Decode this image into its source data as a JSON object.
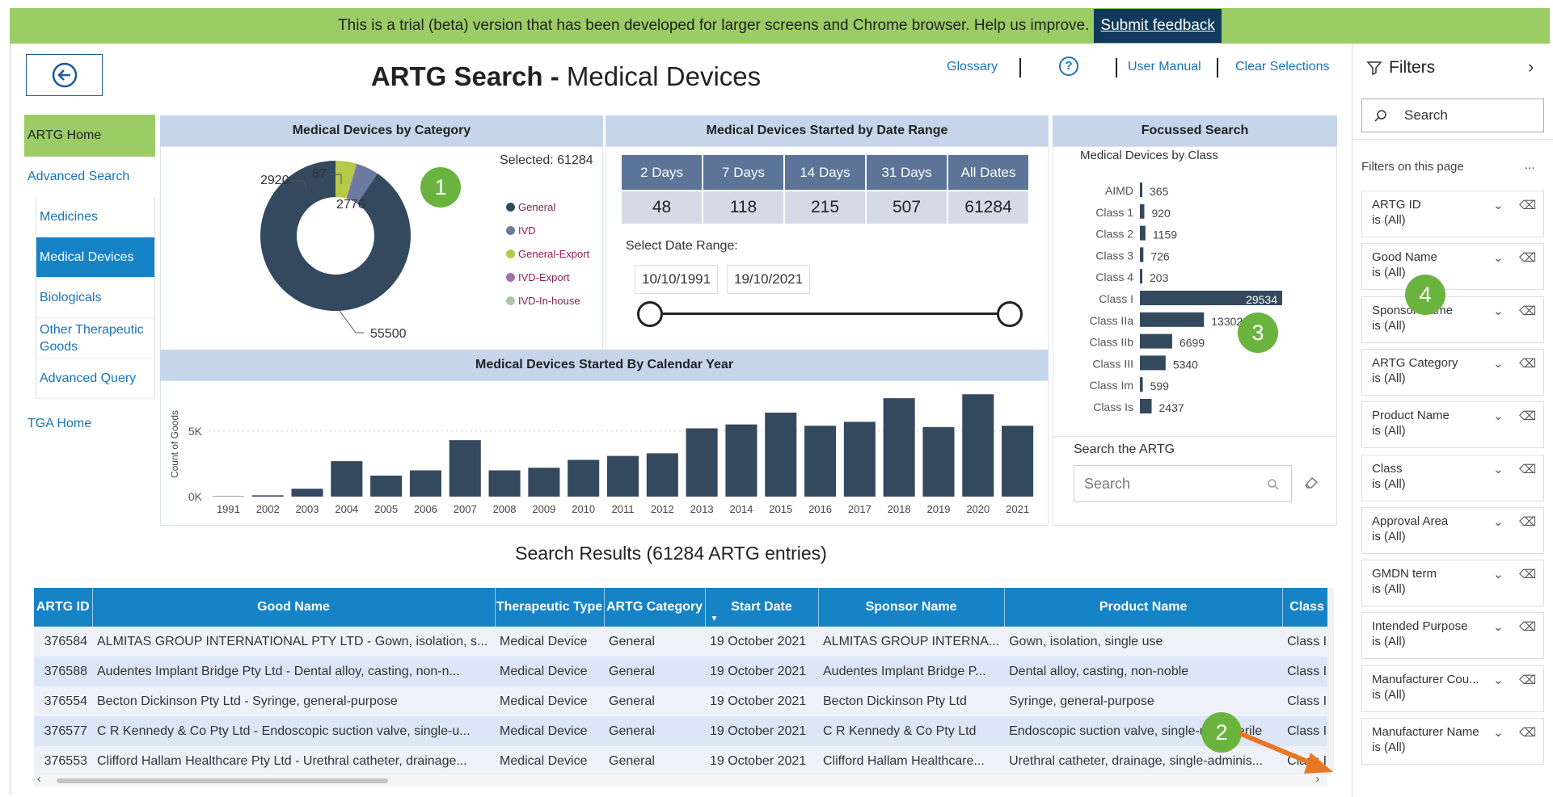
{
  "banner": {
    "message": "This is a trial (beta) version that has been developed for larger screens and Chrome browser. Help us improve.",
    "feedback_label": "Submit feedback"
  },
  "header": {
    "title_bold": "ARTG Search - ",
    "title_rest": "Medical Devices",
    "links": {
      "glossary": "Glossary",
      "help": "?",
      "manual": "User Manual",
      "clear": "Clear Selections"
    }
  },
  "nav": {
    "home": "ARTG Home",
    "advanced": "Advanced Search",
    "items": [
      "Medicines",
      "Medical Devices",
      "Biologicals",
      "Other Therapeutic Goods",
      "Advanced Query"
    ],
    "tga": "TGA Home"
  },
  "category_panel": {
    "title": "Medical Devices by Category",
    "selected": "Selected: 61284"
  },
  "chart_data": [
    {
      "type": "pie",
      "title": "Medical Devices by Category",
      "categories": [
        "General",
        "IVD",
        "General-Export",
        "IVD-Export",
        "IVD-In-house"
      ],
      "values": [
        55500,
        2920,
        2776,
        87,
        1
      ],
      "colors": [
        "#34495e",
        "#6d7aa0",
        "#b5c94a",
        "#9b6fb0",
        "#b0c4a8"
      ],
      "data_labels": [
        "55500",
        "2920",
        "2776",
        "87",
        ""
      ]
    },
    {
      "type": "bar",
      "title": "Medical Devices by Class",
      "categories": [
        "AIMD",
        "Class 1",
        "Class 2",
        "Class 3",
        "Class 4",
        "Class I",
        "Class IIa",
        "Class IIb",
        "Class III",
        "Class Im",
        "Class Is"
      ],
      "values": [
        365,
        920,
        1159,
        726,
        203,
        29534,
        13302,
        6699,
        5340,
        599,
        2437
      ]
    },
    {
      "type": "bar",
      "title": "Medical Devices Started By Calendar Year",
      "ylabel": "Count of Goods",
      "categories": [
        "1991",
        "2002",
        "2003",
        "2004",
        "2005",
        "2006",
        "2007",
        "2008",
        "2009",
        "2010",
        "2011",
        "2012",
        "2013",
        "2014",
        "2015",
        "2016",
        "2017",
        "2018",
        "2019",
        "2020",
        "2021"
      ],
      "values": [
        30,
        100,
        600,
        2700,
        1600,
        2000,
        4300,
        2000,
        2200,
        2800,
        3100,
        3300,
        5200,
        5500,
        6400,
        5400,
        5700,
        7500,
        5300,
        7800,
        5400
      ],
      "ylim": [
        0,
        8000
      ],
      "yticks": [
        "0K",
        "5K"
      ]
    }
  ],
  "date_panel": {
    "title": "Medical Devices Started by Date Range",
    "headers": [
      "2 Days",
      "7 Days",
      "14 Days",
      "31 Days",
      "All Dates"
    ],
    "values": [
      "48",
      "118",
      "215",
      "507",
      "61284"
    ],
    "select_label": "Select Date Range:",
    "from": "10/10/1991",
    "to": "19/10/2021"
  },
  "focus_panel": {
    "title": "Focussed Search",
    "subtitle": "Medical Devices by Class",
    "search_label": "Search the ARTG",
    "search_placeholder": "Search"
  },
  "year_panel": {
    "title": "Medical Devices Started By Calendar Year"
  },
  "results": {
    "title": "Search Results (61284 ARTG entries)",
    "columns": [
      "ARTG ID",
      "Good Name",
      "Therapeutic Type",
      "ARTG Category",
      "Start Date",
      "Sponsor Name",
      "Product Name",
      "Class"
    ],
    "rows": [
      [
        "376584",
        "ALMITAS GROUP INTERNATIONAL PTY LTD - Gown, isolation, s...",
        "Medical Device",
        "General",
        "19 October 2021",
        "ALMITAS GROUP INTERNA...",
        "Gown, isolation, single use",
        "Class I"
      ],
      [
        "376588",
        "Audentes Implant Bridge Pty Ltd - Dental alloy, casting, non-n...",
        "Medical Device",
        "General",
        "19 October 2021",
        "Audentes Implant Bridge P...",
        "Dental alloy, casting, non-noble",
        "Class I"
      ],
      [
        "376554",
        "Becton Dickinson Pty Ltd - Syringe, general-purpose",
        "Medical Device",
        "General",
        "19 October 2021",
        "Becton Dickinson Pty Ltd",
        "Syringe, general-purpose",
        "Class I"
      ],
      [
        "376577",
        "C R Kennedy & Co Pty Ltd - Endoscopic suction valve, single-u...",
        "Medical Device",
        "General",
        "19 October 2021",
        "C R Kennedy & Co Pty Ltd",
        "Endoscopic suction valve, single-use, sterile",
        "Class I"
      ],
      [
        "376553",
        "Clifford Hallam Healthcare Pty Ltd - Urethral catheter, drainage...",
        "Medical Device",
        "General",
        "19 October 2021",
        "Clifford Hallam Healthcare...",
        "Urethral catheter, drainage, single-adminis...",
        "Class I"
      ]
    ]
  },
  "filters": {
    "title": "Filters",
    "search_placeholder": "Search",
    "section": "Filters on this page",
    "more": "...",
    "cards": [
      {
        "name": "ARTG ID",
        "value": "is (All)"
      },
      {
        "name": "Good Name",
        "value": "is (All)"
      },
      {
        "name": "Sponsor Name",
        "value": "is (All)"
      },
      {
        "name": "ARTG Category",
        "value": "is (All)"
      },
      {
        "name": "Product Name",
        "value": "is (All)"
      },
      {
        "name": "Class",
        "value": "is (All)"
      },
      {
        "name": "Approval Area",
        "value": "is (All)"
      },
      {
        "name": "GMDN term",
        "value": "is (All)"
      },
      {
        "name": "Intended Purpose",
        "value": "is (All)"
      },
      {
        "name": "Manufacturer Cou...",
        "value": "is (All)"
      },
      {
        "name": "Manufacturer Name",
        "value": "is (All)"
      }
    ]
  },
  "annotations": {
    "b1": "1",
    "b2": "2",
    "b3": "3",
    "b4": "4"
  },
  "colors": {
    "banner": "#9ccc65",
    "accent": "#1583c6",
    "bar": "#34495e",
    "badge": "#6bb33f",
    "arrow": "#e87722"
  }
}
